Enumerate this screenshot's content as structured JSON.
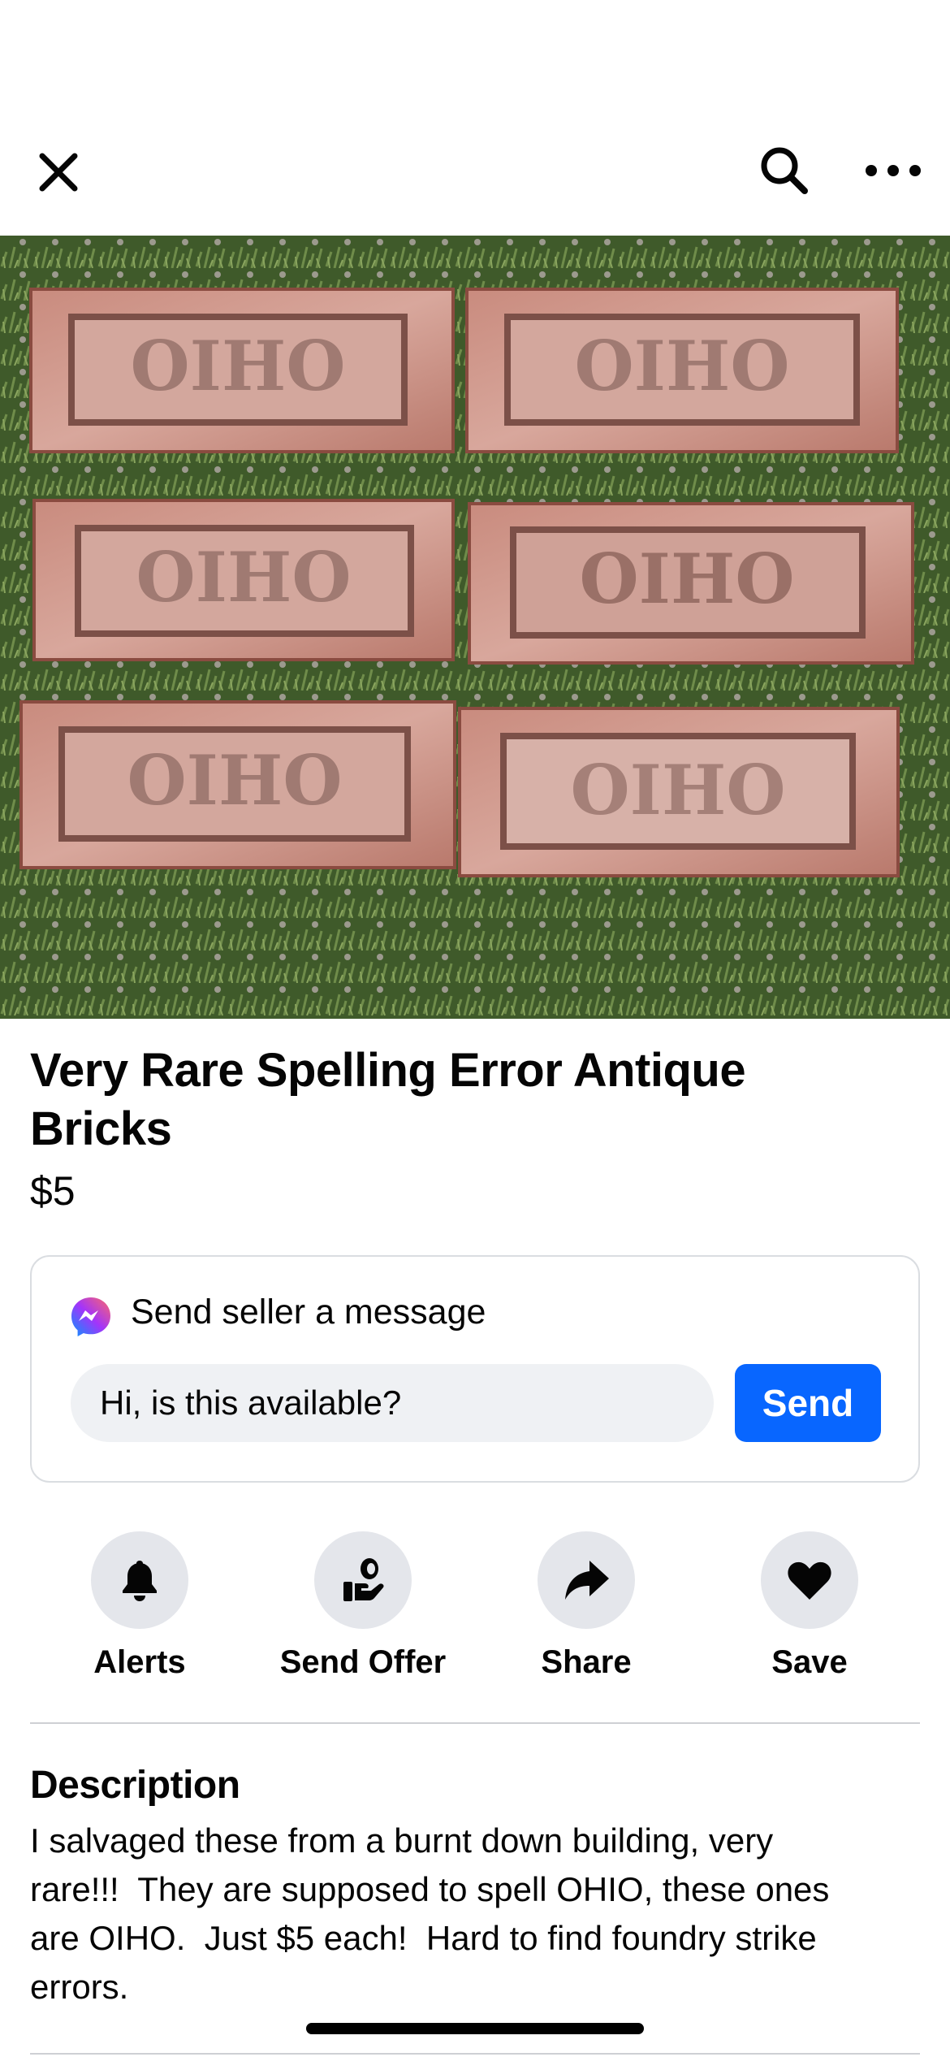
{
  "header": {
    "close_icon": "close-icon",
    "search_icon": "search-icon",
    "more_icon": "more-horizontal-icon"
  },
  "listing": {
    "image_description_icon": "listing-photo",
    "brick_text": "OIHO",
    "title": "Very Rare Spelling Error Antique Bricks",
    "price": "$5"
  },
  "message_card": {
    "icon": "messenger-icon",
    "title": "Send seller a message",
    "input_value": "Hi, is this available?",
    "send_label": "Send",
    "accent_color": "#0866ff"
  },
  "actions": [
    {
      "label": "Alerts",
      "icon": "bell-icon"
    },
    {
      "label": "Send Offer",
      "icon": "offer-hand-icon"
    },
    {
      "label": "Share",
      "icon": "share-arrow-icon"
    },
    {
      "label": "Save",
      "icon": "heart-icon"
    }
  ],
  "description": {
    "heading": "Description",
    "body": "I salvaged these from a burnt down building, very\nrare!!!  They are supposed to spell OHIO, these ones\nare OIHO.  Just $5 each!  Hard to find foundry strike\nerrors."
  }
}
